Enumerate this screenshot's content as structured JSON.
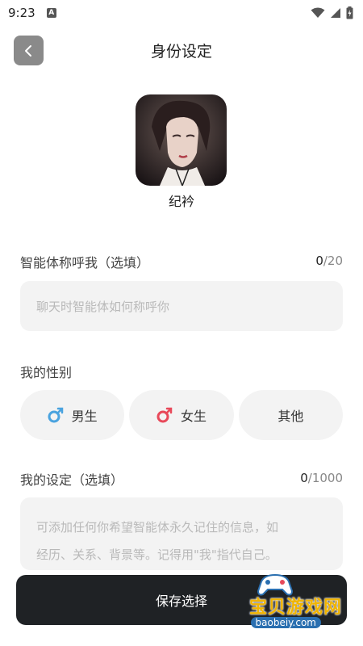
{
  "status_bar": {
    "time": "9:23",
    "notification_letter": "A"
  },
  "header": {
    "title": "身份设定"
  },
  "profile": {
    "name": "纪衿"
  },
  "nickname": {
    "label": "智能体称呼我（选填）",
    "count": "0",
    "max": "/20",
    "placeholder": "聊天时智能体如何称呼你"
  },
  "gender": {
    "label": "我的性别",
    "options": [
      {
        "label": "男生",
        "icon": "male-icon",
        "color": "#4aa3df"
      },
      {
        "label": "女生",
        "icon": "female-icon",
        "color": "#e8495a"
      },
      {
        "label": "其他"
      }
    ]
  },
  "settings": {
    "label": "我的设定（选填）",
    "count": "0",
    "max": "/1000",
    "placeholder_line1": "可添加任何你希望智能体永久记住的信息，如",
    "placeholder_line2": "经历、关系、背景等。记得用\"我\"指代自己。"
  },
  "save_button": {
    "label": "保存选择"
  },
  "watermark": {
    "text": "宝贝游戏网",
    "url": "baobeiy.com"
  },
  "colors": {
    "save_bar": "#1f2225",
    "input_bg": "#f3f3f3",
    "watermark": "#f0b400"
  }
}
